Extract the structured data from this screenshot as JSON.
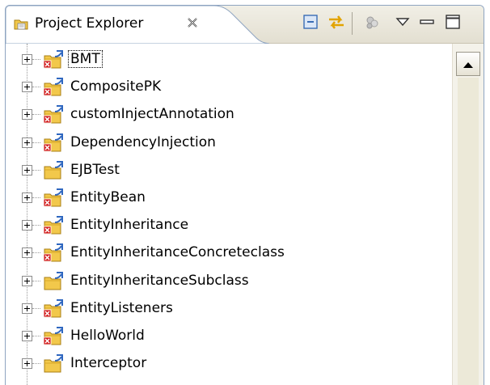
{
  "view": {
    "tab_title": "Project Explorer",
    "tab_icon": "folder-icon",
    "close_icon": "close-icon",
    "toolbar": [
      {
        "name": "collapse-all-button",
        "icon": "collapse-all-icon"
      },
      {
        "name": "link-with-editor-button",
        "icon": "link-with-editor-icon"
      },
      {
        "name": "filter-button",
        "icon": "filter-icon"
      },
      {
        "name": "view-menu-button",
        "icon": "chevron-down-icon"
      },
      {
        "name": "minimize-button",
        "icon": "minimize-icon"
      },
      {
        "name": "maximize-button",
        "icon": "maximize-icon"
      }
    ]
  },
  "tree": {
    "projects": [
      {
        "label": "BMT",
        "has_error": true,
        "focused": true
      },
      {
        "label": "CompositePK",
        "has_error": true
      },
      {
        "label": "customInjectAnnotation",
        "has_error": true
      },
      {
        "label": "DependencyInjection",
        "has_error": true
      },
      {
        "label": "EJBTest",
        "has_error": false
      },
      {
        "label": "EntityBean",
        "has_error": true
      },
      {
        "label": "EntityInheritance",
        "has_error": true
      },
      {
        "label": "EntityInheritanceConcreteclass",
        "has_error": true
      },
      {
        "label": "EntityInheritanceSubclass",
        "has_error": false
      },
      {
        "label": "EntityListeners",
        "has_error": true
      },
      {
        "label": "HelloWorld",
        "has_error": true
      },
      {
        "label": "Interceptor",
        "has_error": false
      }
    ]
  },
  "colors": {
    "error_marker": "#d22222",
    "folder": "#f2c84b",
    "header_bg": "#e8e4d6",
    "view_border": "#8ea4c1"
  }
}
